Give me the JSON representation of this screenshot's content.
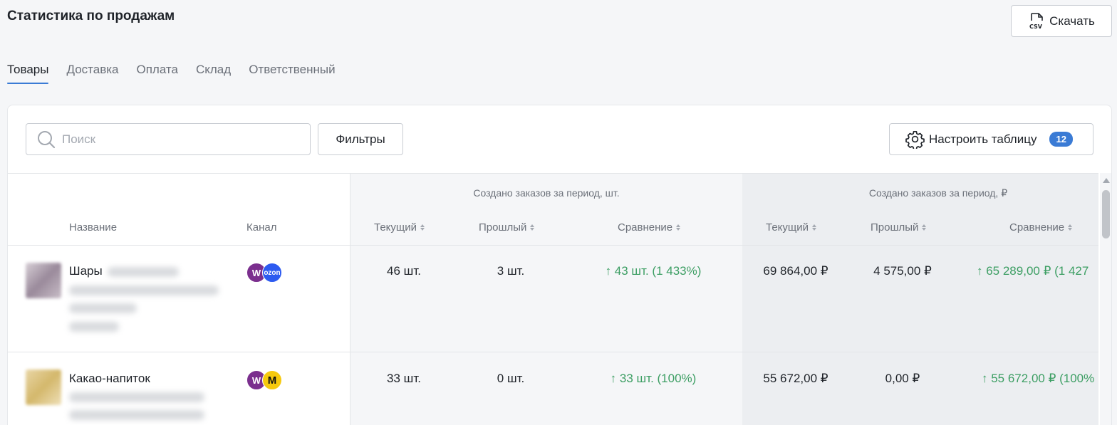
{
  "page": {
    "title": "Статистика по продажам"
  },
  "download": {
    "label": "Скачать",
    "icon": "csv-file-icon"
  },
  "tabs": [
    {
      "label": "Товары",
      "active": true
    },
    {
      "label": "Доставка",
      "active": false
    },
    {
      "label": "Оплата",
      "active": false
    },
    {
      "label": "Склад",
      "active": false
    },
    {
      "label": "Ответственный",
      "active": false
    }
  ],
  "toolbar": {
    "search_placeholder": "Поиск",
    "filters_label": "Фильтры",
    "configure_label": "Настроить таблицу",
    "configure_badge": "12"
  },
  "table": {
    "groups": [
      {
        "title": "Создано заказов за период, шт."
      },
      {
        "title": "Создано заказов за период, ₽"
      }
    ],
    "columns": {
      "name": "Название",
      "channel": "Канал",
      "current": "Текущий",
      "previous": "Прошлый",
      "comparison": "Сравнение"
    },
    "rows": [
      {
        "name": "Шары",
        "channels": [
          "W",
          "ozon"
        ],
        "qty_current": "46 шт.",
        "qty_previous": "3 шт.",
        "qty_comparison": "↑ 43 шт. (1 433%)",
        "rub_current": "69 864,00 ₽",
        "rub_previous": "4 575,00 ₽",
        "rub_comparison": "↑ 65 289,00 ₽ (1 427"
      },
      {
        "name": "Какао-напиток",
        "channels": [
          "W",
          "M"
        ],
        "qty_current": "33 шт.",
        "qty_previous": "0 шт.",
        "qty_comparison": "↑ 33 шт. (100%)",
        "rub_current": "55 672,00 ₽",
        "rub_previous": "0,00 ₽",
        "rub_comparison": "↑ 55 672,00 ₽ (100%"
      }
    ]
  },
  "colors": {
    "accent": "#3a7bd5",
    "positive": "#3c9e63",
    "wildberries": "#7b2f8e",
    "ozon": "#2d5bf0",
    "yandex_market": "#f6c90e"
  }
}
